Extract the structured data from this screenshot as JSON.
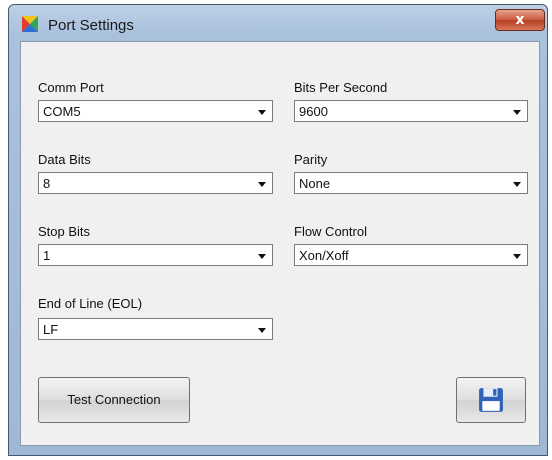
{
  "window": {
    "title": "Port Settings",
    "close_label": "x"
  },
  "fields": {
    "comm_port": {
      "label": "Comm Port",
      "value": "COM5"
    },
    "bits_per_second": {
      "label": "Bits Per Second",
      "value": "9600"
    },
    "data_bits": {
      "label": "Data Bits",
      "value": "8"
    },
    "parity": {
      "label": "Parity",
      "value": "None"
    },
    "stop_bits": {
      "label": "Stop Bits",
      "value": "1"
    },
    "flow_control": {
      "label": "Flow Control",
      "value": "Xon/Xoff"
    },
    "eol": {
      "label": "End of Line (EOL)",
      "value": "LF"
    }
  },
  "buttons": {
    "test_connection": "Test Connection",
    "save_icon": "floppy-disk-icon"
  },
  "colors": {
    "title_bar": "#a9c1dd",
    "close_button": "#c85a3e",
    "client_background": "#f0f0f0",
    "save_icon": "#2f62b8"
  }
}
